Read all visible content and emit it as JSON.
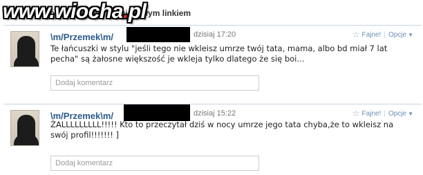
{
  "top": {
    "text": "Inne osoby ... podziel się ciekawym linkiem",
    "watermark": "www.wiocha.pl"
  },
  "posts": [
    {
      "author": "\\m/Przemek\\m/",
      "time": "dzisiaj 17:20",
      "like_label": "Fajne!",
      "options_label": "Opcje",
      "text": "Te łańcuszki w stylu \"jeśli tego nie wkleisz umrze twój tata, mama, albo bd miał 7 lat pecha\" są żałosne większość je wkleja tylko dlatego że się boi...",
      "comment_placeholder": "Dodaj komentarz"
    },
    {
      "author": "\\m/Przemek\\m/",
      "time": "dzisiaj 15:22",
      "like_label": "Fajne!",
      "options_label": "Opcje",
      "text": "ŻALLLLLLLLL!!!!! Kto to przeczytał dziś w nocy umrze jego tata chyba,że to wkleisz na swój profil!!!!!!! ]",
      "comment_placeholder": "Dodaj komentarz"
    }
  ]
}
